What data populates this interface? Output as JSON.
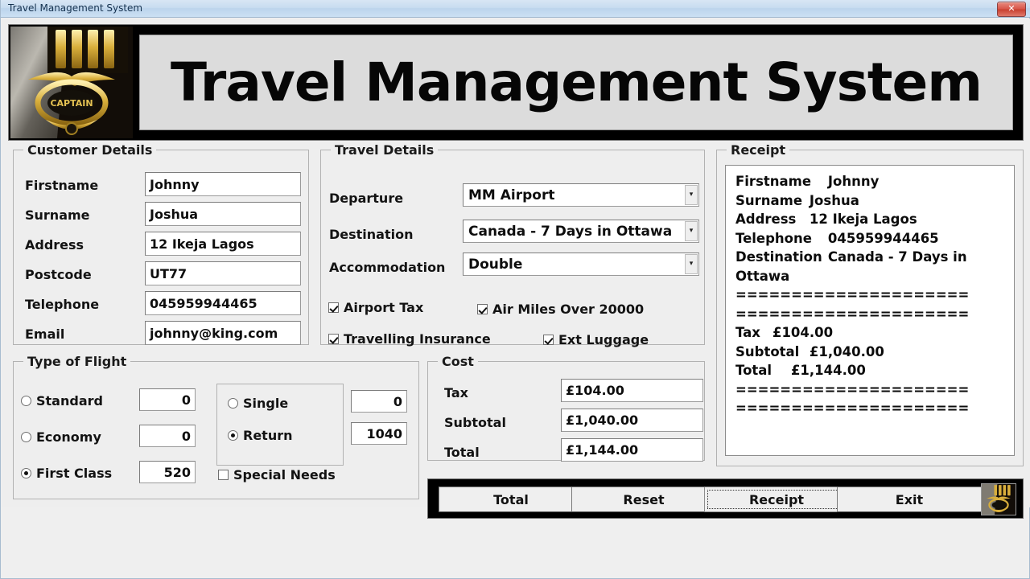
{
  "window": {
    "title": "Travel Management System",
    "close_label": "✕"
  },
  "banner": {
    "heading": "Travel Management System",
    "logo_name": "captain-wings-medal"
  },
  "customer_details": {
    "legend": "Customer Details",
    "fields": [
      {
        "label": "Firstname",
        "value": "Johnny"
      },
      {
        "label": "Surname",
        "value": "Joshua"
      },
      {
        "label": "Address",
        "value": "12 Ikeja Lagos"
      },
      {
        "label": "Postcode",
        "value": "UT77"
      },
      {
        "label": "Telephone",
        "value": "045959944465"
      },
      {
        "label": "Email",
        "value": "johnny@king.com"
      }
    ]
  },
  "travel_details": {
    "legend": "Travel Details",
    "departure": {
      "label": "Departure",
      "value": "MM Airport"
    },
    "destination": {
      "label": "Destination",
      "value": "Canada - 7 Days in Ottawa"
    },
    "accommodation": {
      "label": "Accommodation",
      "value": "Double"
    },
    "options": [
      {
        "label": "Airport Tax",
        "checked": true
      },
      {
        "label": "Air Miles Over 20000",
        "checked": true
      },
      {
        "label": "Travelling Insurance",
        "checked": true
      },
      {
        "label": "Ext Luggage",
        "checked": true
      }
    ]
  },
  "type_of_flight": {
    "legend": "Type of Flight",
    "classes": [
      {
        "label": "Standard",
        "selected": false,
        "value": "0"
      },
      {
        "label": "Economy",
        "selected": false,
        "value": "0"
      },
      {
        "label": "First Class",
        "selected": true,
        "value": "520"
      }
    ],
    "trip": [
      {
        "label": "Single",
        "selected": false,
        "value": "0"
      },
      {
        "label": "Return",
        "selected": true,
        "value": "1040"
      }
    ],
    "special_needs": {
      "label": "Special Needs",
      "checked": false
    }
  },
  "cost": {
    "legend": "Cost",
    "rows": [
      {
        "label": "Tax",
        "value": "£104.00"
      },
      {
        "label": "Subtotal",
        "value": "£1,040.00"
      },
      {
        "label": "Total",
        "value": "£1,144.00"
      }
    ]
  },
  "receipt": {
    "legend": "Receipt",
    "text": "Firstname\tJohnny\nSurname\tJoshua\nAddress\t12 Ikeja Lagos\nTelephone\t045959944465\nDestination\tCanada - 7 Days in Ottawa\n=====================\n=====================\nTax\t£104.00\nSubtotal\t£1,040.00\nTotal\t£1,144.00\n=====================\n====================="
  },
  "buttons": {
    "total": "Total",
    "reset": "Reset",
    "receipt": "Receipt",
    "exit": "Exit",
    "logo_name": "captain-wings-medal"
  }
}
